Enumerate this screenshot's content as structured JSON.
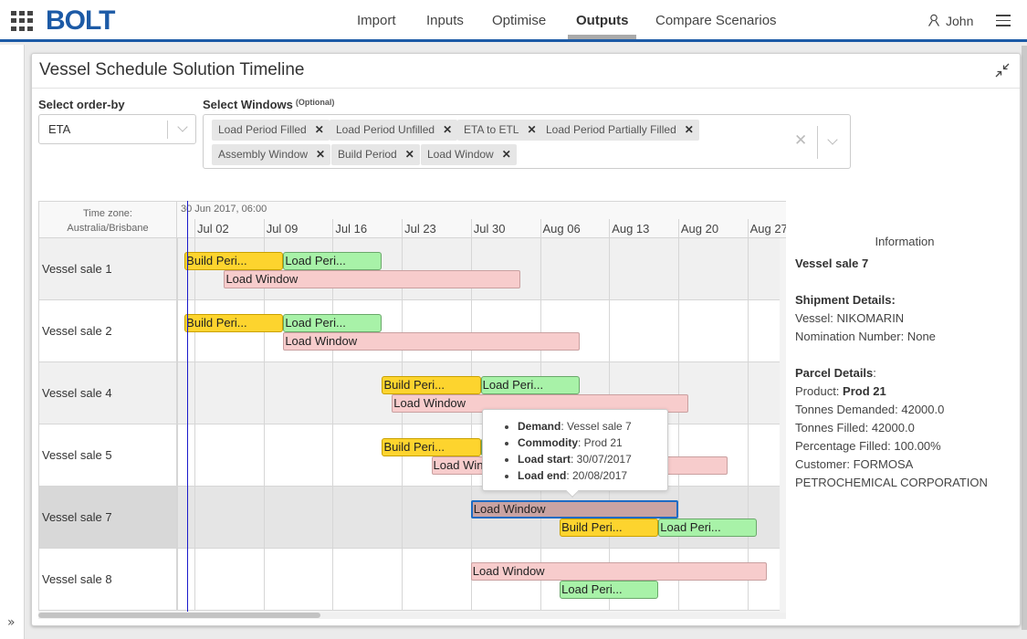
{
  "app": {
    "brand": "BOLT",
    "nav": [
      {
        "label": "Import",
        "active": false
      },
      {
        "label": "Inputs",
        "active": false
      },
      {
        "label": "Optimise",
        "active": false
      },
      {
        "label": "Outputs",
        "active": true
      },
      {
        "label": "Compare Scenarios",
        "active": false
      }
    ],
    "user": "John"
  },
  "panel": {
    "title": "Vessel Schedule Solution Timeline",
    "order_by": {
      "label": "Select order-by",
      "value": "ETA"
    },
    "windows": {
      "label": "Select Windows",
      "optional": "(Optional)",
      "chips": [
        "Load Period Filled",
        "Load Period Unfilled",
        "ETA to ETL",
        "Load Period Partially Filled",
        "Assembly Window",
        "Build Period",
        "Load Window"
      ]
    }
  },
  "timeline": {
    "timezone_label": "Time zone:",
    "timezone": "Australia/Brisbane",
    "start_label": "30 Jun 2017, 06:00",
    "ticks": [
      "Jul 02",
      "Jul 09",
      "Jul 16",
      "Jul 23",
      "Jul 30",
      "Aug 06",
      "Aug 13",
      "Aug 20",
      "Aug 27"
    ],
    "rows": [
      {
        "name": "Vessel sale 1",
        "selected": false,
        "bars": [
          {
            "type": "build",
            "label": "Build Peri...",
            "start": -1,
            "end": 9,
            "lane": 0
          },
          {
            "type": "loadp",
            "label": "Load Peri...",
            "start": 9,
            "end": 19,
            "lane": 0
          },
          {
            "type": "window",
            "label": "Load Window",
            "start": 3,
            "end": 33,
            "lane": 1
          }
        ]
      },
      {
        "name": "Vessel sale 2",
        "selected": false,
        "bars": [
          {
            "type": "build",
            "label": "Build Peri...",
            "start": -1,
            "end": 9,
            "lane": 0
          },
          {
            "type": "loadp",
            "label": "Load Peri...",
            "start": 9,
            "end": 19,
            "lane": 0
          },
          {
            "type": "window",
            "label": "Load Window",
            "start": 9,
            "end": 39,
            "lane": 1
          }
        ]
      },
      {
        "name": "Vessel sale 4",
        "selected": false,
        "bars": [
          {
            "type": "build",
            "label": "Build Peri...",
            "start": 19,
            "end": 29,
            "lane": 0
          },
          {
            "type": "loadp",
            "label": "Load Peri...",
            "start": 29,
            "end": 39,
            "lane": 0
          },
          {
            "type": "window",
            "label": "Load Window",
            "start": 20,
            "end": 50,
            "lane": 1
          }
        ]
      },
      {
        "name": "Vessel sale 5",
        "selected": false,
        "bars": [
          {
            "type": "build",
            "label": "Build Peri...",
            "start": 19,
            "end": 29,
            "lane": 0
          },
          {
            "type": "loadp",
            "label": "Load Peri...",
            "start": 29,
            "end": 39,
            "lane": 0
          },
          {
            "type": "window",
            "label": "Load Window",
            "start": 24,
            "end": 54,
            "lane": 1
          }
        ]
      },
      {
        "name": "Vessel sale 7",
        "selected": true,
        "bars": [
          {
            "type": "window",
            "label": "Load Window",
            "start": 28,
            "end": 49,
            "lane": 0,
            "selected": true
          },
          {
            "type": "build",
            "label": "Build Peri...",
            "start": 37,
            "end": 47,
            "lane": 1
          },
          {
            "type": "loadp",
            "label": "Load Peri...",
            "start": 47,
            "end": 57,
            "lane": 1
          }
        ]
      },
      {
        "name": "Vessel sale 8",
        "selected": false,
        "bars": [
          {
            "type": "window",
            "label": "Load Window",
            "start": 28,
            "end": 58,
            "lane": 0
          },
          {
            "type": "loadp",
            "label": "Load Peri...",
            "start": 37,
            "end": 47,
            "lane": 1
          }
        ]
      }
    ]
  },
  "tooltip": {
    "items": [
      {
        "key": "Demand",
        "value": "Vessel sale 7"
      },
      {
        "key": "Commodity",
        "value": "Prod 21"
      },
      {
        "key": "Load start",
        "value": "30/07/2017"
      },
      {
        "key": "Load end",
        "value": "20/08/2017"
      }
    ]
  },
  "info": {
    "title": "Information",
    "demand": "Vessel sale 7",
    "shipment_heading": "Shipment Details:",
    "vessel": "Vessel: NIKOMARIN",
    "nomination": "Nomination Number: None",
    "parcel_heading": "Parcel Details",
    "product_label": "Product: ",
    "product": "Prod 21",
    "tonnes_demanded": "Tonnes Demanded: 42000.0",
    "tonnes_filled": "Tonnes Filled: 42000.0",
    "percentage_filled": "Percentage Filled: 100.00%",
    "customer": "Customer: FORMOSA PETROCHEMICAL CORPORATION"
  },
  "colors": {
    "brand": "#1c5aa6",
    "build_period": "#fdd42e",
    "load_period": "#a8f2a8",
    "load_window": "#f7cccc",
    "load_window_selected": "#c9a3a3",
    "now_line": "#1a1acc",
    "selection_border": "#1d6bc4"
  }
}
